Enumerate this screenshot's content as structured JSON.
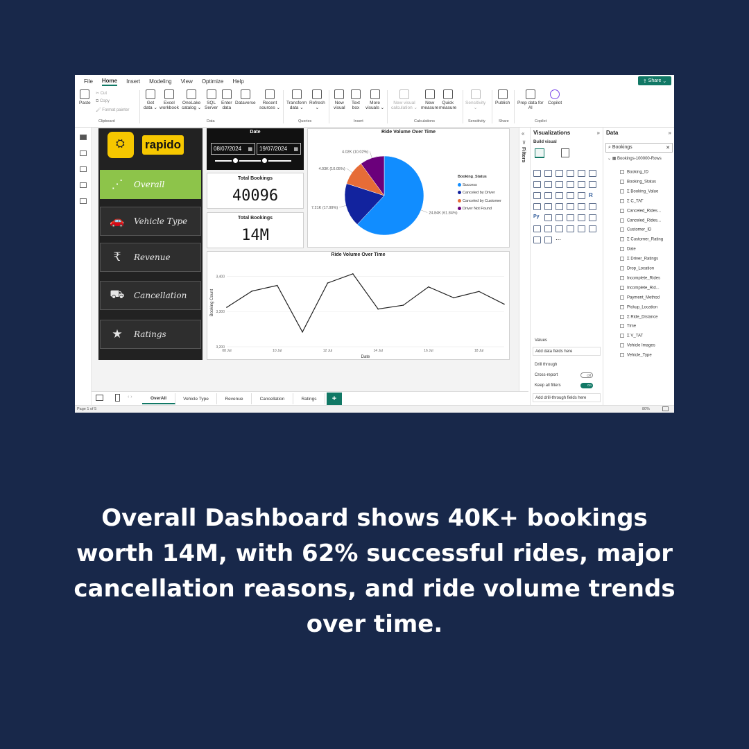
{
  "menu": {
    "tabs": [
      "File",
      "Home",
      "Insert",
      "Modeling",
      "View",
      "Optimize",
      "Help"
    ],
    "active": "Home",
    "share": "Share"
  },
  "ribbon": {
    "paste": "Paste",
    "cut": "Cut",
    "copy": "Copy",
    "format_painter": "Format painter",
    "buttons": [
      {
        "l1": "Get",
        "l2": "data ⌄"
      },
      {
        "l1": "Excel",
        "l2": "workbook"
      },
      {
        "l1": "OneLake",
        "l2": "catalog ⌄"
      },
      {
        "l1": "SQL",
        "l2": "Server"
      },
      {
        "l1": "Enter",
        "l2": "data"
      },
      {
        "l1": "Dataverse",
        "l2": ""
      },
      {
        "l1": "Recent",
        "l2": "sources ⌄"
      },
      {
        "l1": "Transform",
        "l2": "data ⌄"
      },
      {
        "l1": "Refresh",
        "l2": "⌄"
      },
      {
        "l1": "New",
        "l2": "visual"
      },
      {
        "l1": "Text",
        "l2": "box"
      },
      {
        "l1": "More",
        "l2": "visuals ⌄"
      },
      {
        "l1": "New visual",
        "l2": "calculation ⌄"
      },
      {
        "l1": "New",
        "l2": "measure"
      },
      {
        "l1": "Quick",
        "l2": "measure"
      },
      {
        "l1": "Sensitivity",
        "l2": "⌄"
      },
      {
        "l1": "Publish",
        "l2": ""
      },
      {
        "l1": "Prep data for",
        "l2": "AI"
      },
      {
        "l1": "Copilot",
        "l2": ""
      }
    ],
    "groups": [
      "Clipboard",
      "Data",
      "Queries",
      "Insert",
      "Calculations",
      "Sensitivity",
      "Share",
      "Copilot"
    ]
  },
  "nav": {
    "logo_text": "rapido",
    "items": [
      {
        "label": "Overall",
        "icon": "⋰"
      },
      {
        "label": "Vehicle Type",
        "icon": "🚗"
      },
      {
        "label": "Revenue",
        "icon": "₹"
      },
      {
        "label": "Cancellation",
        "icon": "⛟"
      },
      {
        "label": "Ratings",
        "icon": "★"
      }
    ]
  },
  "date_filter": {
    "label": "Date",
    "start": "08/07/2024",
    "end": "19/07/2024",
    "start_pos": 0.27,
    "end_pos": 0.65
  },
  "cards": [
    {
      "label": "Total Bookings",
      "value": "40096"
    },
    {
      "label": "Total Bookings",
      "value": "14M"
    }
  ],
  "chart_data": [
    {
      "type": "pie",
      "title": "Ride Volume Over Time",
      "legend_title": "Booking_Status",
      "legend_position": "right",
      "slices": [
        {
          "name": "Success",
          "value": 24.84,
          "label": "24.84K (61.84%)",
          "color": "#118dff"
        },
        {
          "name": "Canceled by Driver",
          "value": 7.21,
          "label": "7.21K (17.99%)",
          "color": "#12239e"
        },
        {
          "name": "Canceled by Customer",
          "value": 4.03,
          "label": "4.03K (10.05%)",
          "color": "#e66c37"
        },
        {
          "name": "Driver Not Found",
          "value": 4.02,
          "label": "4.02K (10.02%)",
          "color": "#6b007b"
        }
      ]
    },
    {
      "type": "line",
      "title": "Ride Volume Over Time",
      "xlabel": "Date",
      "ylabel": "Booking Count",
      "x_ticks": [
        "08 Jul",
        "10 Jul",
        "12 Jul",
        "14 Jul",
        "16 Jul",
        "18 Jul"
      ],
      "y_ticks": [
        "3,200",
        "3,300",
        "3,400"
      ],
      "ylim": [
        3200,
        3450
      ],
      "x": [
        "08 Jul",
        "09 Jul",
        "10 Jul",
        "11 Jul",
        "12 Jul",
        "13 Jul",
        "14 Jul",
        "15 Jul",
        "16 Jul",
        "17 Jul",
        "18 Jul",
        "19 Jul"
      ],
      "values": [
        3312,
        3358,
        3374,
        3242,
        3381,
        3407,
        3307,
        3318,
        3370,
        3339,
        3357,
        3321
      ],
      "color": "#222222"
    }
  ],
  "panes": {
    "filters": "Filters",
    "visualizations": "Visualizations",
    "build_visual": "Build visual",
    "values_label": "Values",
    "add_data": "Add data fields here",
    "drill_through": "Drill through",
    "cross_report": "Cross-report",
    "cross_report_state": "Off",
    "keep_filters": "Keep all filters",
    "keep_filters_state": "On",
    "add_drill": "Add drill-through fields here",
    "data": "Data",
    "search": "Bookings",
    "table": "Bookings-100000-Rows",
    "fields": [
      "Booking_ID",
      "Booking_Status",
      "Booking_Value",
      "C_TAT",
      "Canceled_Rides...",
      "Canceled_Rides...",
      "Customer_ID",
      "Customer_Rating",
      "Date",
      "Driver_Ratings",
      "Drop_Location",
      "Incomplete_Rides",
      "Incomplete_Rid...",
      "Payment_Method",
      "Pickup_Location",
      "Ride_Distance",
      "Time",
      "V_TAT",
      "Vehicle Images",
      "Vehicle_Type"
    ],
    "sigma_fields": [
      "Booking_Value",
      "C_TAT",
      "Customer_Rating",
      "Driver_Ratings",
      "Ride_Distance",
      "V_TAT"
    ]
  },
  "page_tabs": [
    "OverAll",
    "Vehicle Type",
    "Revenue",
    "Cancellation",
    "Ratings"
  ],
  "status": {
    "page": "Page 1 of 5",
    "zoom": "80%"
  },
  "caption": "Overall Dashboard shows 40K+ bookings worth 14M, with 62% successful rides, major cancellation reasons, and ride volume trends over time."
}
